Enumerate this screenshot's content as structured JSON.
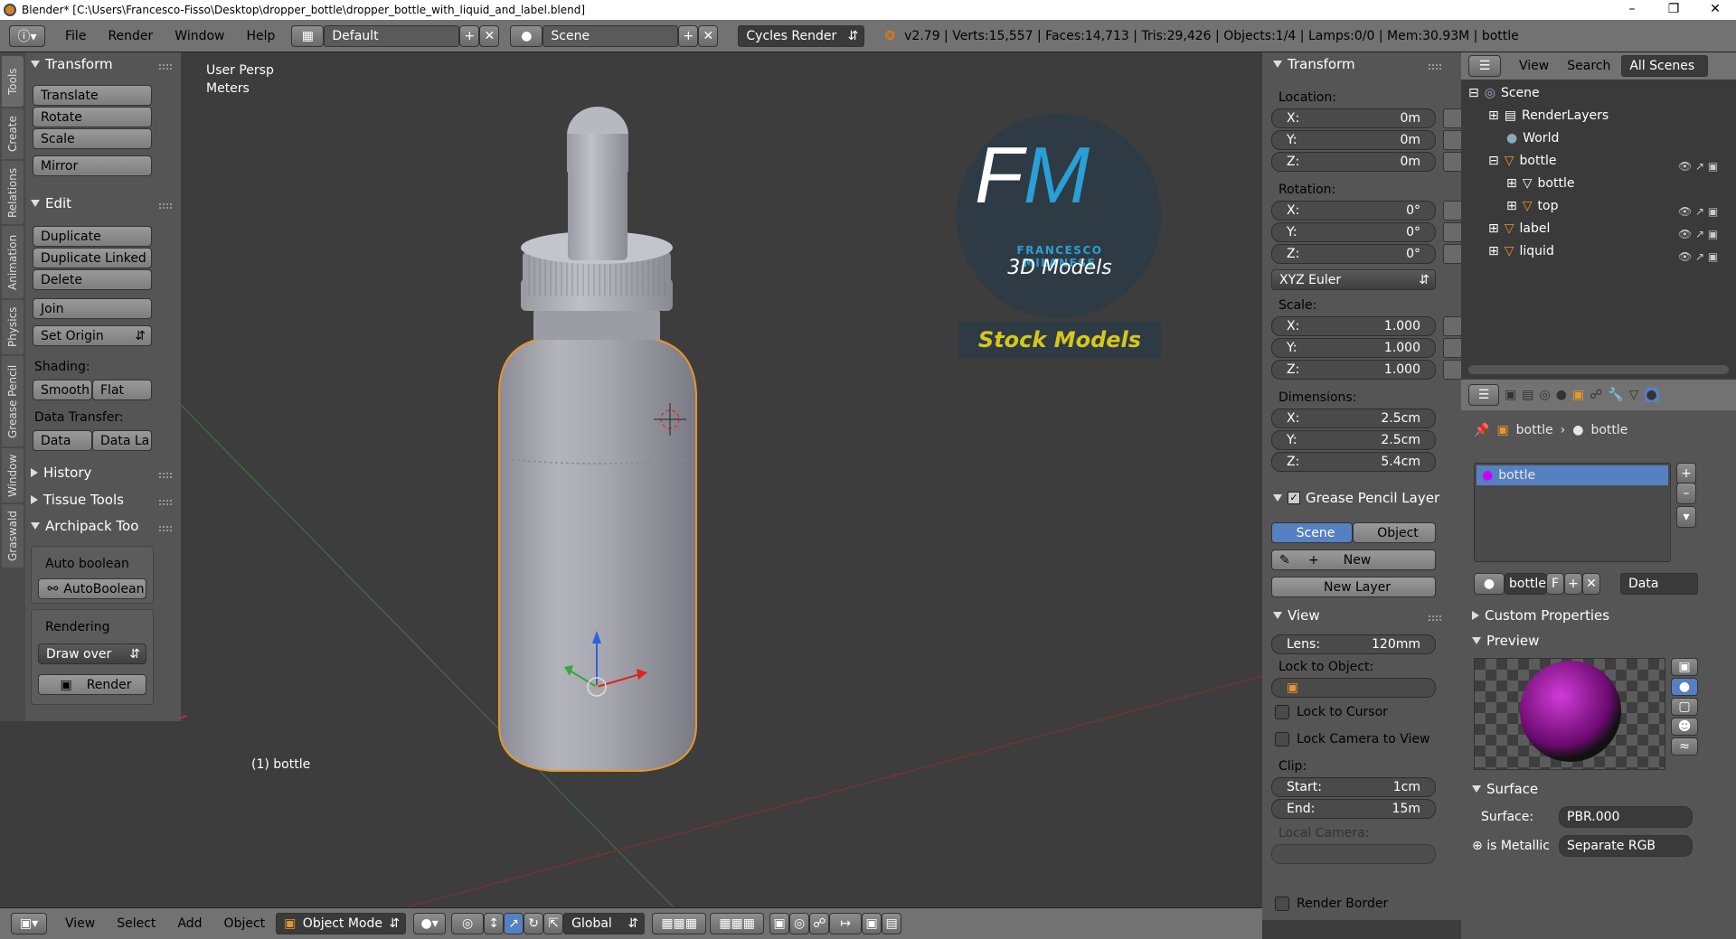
{
  "window": {
    "title": "Blender* [C:\\Users\\Francesco-Fisso\\Desktop\\dropper_bottle\\dropper_bottle_with_liquid_and_label.blend]"
  },
  "infobar": {
    "menus": [
      "File",
      "Render",
      "Window",
      "Help"
    ],
    "layout": "Default",
    "scene": "Scene",
    "engine": "Cycles Render",
    "stats": "v2.79 | Verts:15,557 | Faces:14,713 | Tris:29,426 | Objects:1/4 | Lamps:0/0 | Mem:30.93M | bottle"
  },
  "lefttabs": [
    "Tools",
    "Create",
    "Relations",
    "Animation",
    "Physics",
    "Grease Pencil",
    "Window",
    "Graswald"
  ],
  "toolshelf": {
    "transform": {
      "title": "Transform",
      "buttons": [
        "Translate",
        "Rotate",
        "Scale",
        "Mirror"
      ]
    },
    "edit": {
      "title": "Edit",
      "buttons": [
        "Duplicate",
        "Duplicate Linked",
        "Delete",
        "Join",
        "Set Origin"
      ]
    },
    "shading": {
      "label": "Shading:",
      "smooth": "Smooth",
      "flat": "Flat"
    },
    "datatransfer": {
      "label": "Data Transfer:",
      "data": "Data",
      "datala": "Data La"
    },
    "history": "History",
    "tissue": "Tissue Tools",
    "archipack": "Archipack Too",
    "autoboolean_label": "Auto boolean",
    "autoboolean_btn": "AutoBoolean",
    "rendering_label": "Rendering",
    "drawover": "Draw over",
    "render_btn": "Render"
  },
  "viewport": {
    "persp": "User Persp",
    "units": "Meters",
    "object": "(1) bottle",
    "logo": {
      "fm": "FM",
      "name": "FRANCESCO MILANESE",
      "sub": "3D Models",
      "stock": "Stock Models"
    }
  },
  "npanel": {
    "transform_title": "Transform",
    "location_label": "Location:",
    "location": [
      {
        "k": "X:",
        "v": "0m"
      },
      {
        "k": "Y:",
        "v": "0m"
      },
      {
        "k": "Z:",
        "v": "0m"
      }
    ],
    "rotation_label": "Rotation:",
    "rotation": [
      {
        "k": "X:",
        "v": "0°"
      },
      {
        "k": "Y:",
        "v": "0°"
      },
      {
        "k": "Z:",
        "v": "0°"
      }
    ],
    "rotmode": "XYZ Euler",
    "scale_label": "Scale:",
    "scale": [
      {
        "k": "X:",
        "v": "1.000"
      },
      {
        "k": "Y:",
        "v": "1.000"
      },
      {
        "k": "Z:",
        "v": "1.000"
      }
    ],
    "dim_label": "Dimensions:",
    "dimensions": [
      {
        "k": "X:",
        "v": "2.5cm"
      },
      {
        "k": "Y:",
        "v": "2.5cm"
      },
      {
        "k": "Z:",
        "v": "5.4cm"
      }
    ],
    "gp_title": "Grease Pencil Layer",
    "gp_scene": "Scene",
    "gp_object": "Object",
    "gp_new": "New",
    "gp_newlayer": "New Layer",
    "view_title": "View",
    "lens_k": "Lens:",
    "lens_v": "120mm",
    "lockobj": "Lock to Object:",
    "lockcursor": "Lock to Cursor",
    "lockcamera": "Lock Camera to View",
    "clip": "Clip:",
    "clip_start_k": "Start:",
    "clip_start_v": "1cm",
    "clip_end_k": "End:",
    "clip_end_v": "15m",
    "localcam": "Local Camera:",
    "renderborder": "Render Border"
  },
  "outliner": {
    "view": "View",
    "search": "Search",
    "allscenes": "All Scenes",
    "items": [
      {
        "label": "Scene"
      },
      {
        "label": "RenderLayers"
      },
      {
        "label": "World"
      },
      {
        "label": "bottle"
      },
      {
        "label": "bottle"
      },
      {
        "label": "top"
      },
      {
        "label": "label"
      },
      {
        "label": "liquid"
      }
    ]
  },
  "props": {
    "crumb1": "bottle",
    "crumb2": "bottle",
    "slot": "bottle",
    "matname": "bottle",
    "f": "F",
    "data": "Data",
    "custom": "Custom Properties",
    "preview": "Preview",
    "surface_title": "Surface",
    "surface_k": "Surface:",
    "surface_v": "PBR.000",
    "metallic_k": "is Metallic",
    "metallic_v": "Separate RGB"
  },
  "bottombar": {
    "menus": [
      "View",
      "Select",
      "Add",
      "Object"
    ],
    "mode": "Object Mode",
    "orient": "Global"
  }
}
